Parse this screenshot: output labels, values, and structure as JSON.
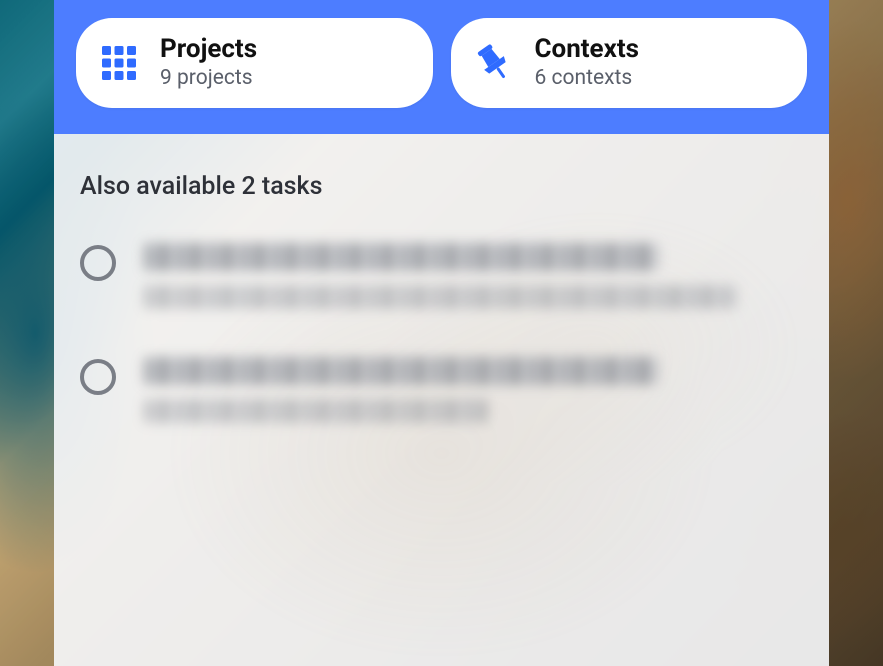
{
  "header": {
    "projects": {
      "title": "Projects",
      "subtitle": "9 projects"
    },
    "contexts": {
      "title": "Contexts",
      "subtitle": "6 contexts"
    }
  },
  "section": {
    "heading": "Also available 2 tasks"
  },
  "tasks": [
    {
      "title_obscured": true,
      "meta_obscured": true
    },
    {
      "title_obscured": true,
      "meta_obscured": true
    }
  ]
}
